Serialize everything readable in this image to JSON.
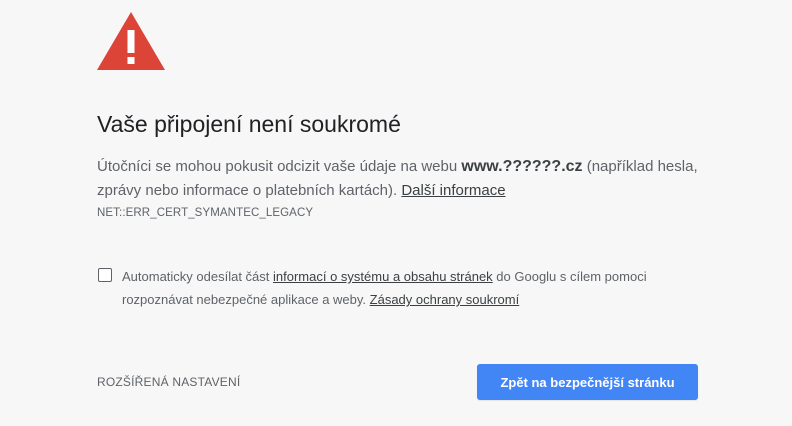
{
  "colors": {
    "background": "#f7f7f7",
    "warning_red": "#db4437",
    "primary_blue": "#4285f4"
  },
  "icon": "warning-triangle-icon",
  "title": "Vaše připojení není soukromé",
  "message": {
    "part1": "Útočníci se mohou pokusit odcizit vaše údaje na webu ",
    "domain": "www.??????.cz",
    "part2": " (například hesla, zprávy nebo informace o platebních kartách). ",
    "learn_more": "Další informace"
  },
  "error_code": "NET::ERR_CERT_SYMANTEC_LEGACY",
  "report": {
    "checked": false,
    "part1": "Automaticky odesílat část ",
    "link1": "informací o systému a obsahu stránek",
    "part2": " do Googlu s cílem pomoci rozpoznávat nebezpečné aplikace a weby. ",
    "link2": "Zásady ochrany soukromí"
  },
  "buttons": {
    "advanced": "ROZŠÍŘENÁ NASTAVENÍ",
    "back_to_safety": "Zpět na bezpečnější stránku"
  }
}
